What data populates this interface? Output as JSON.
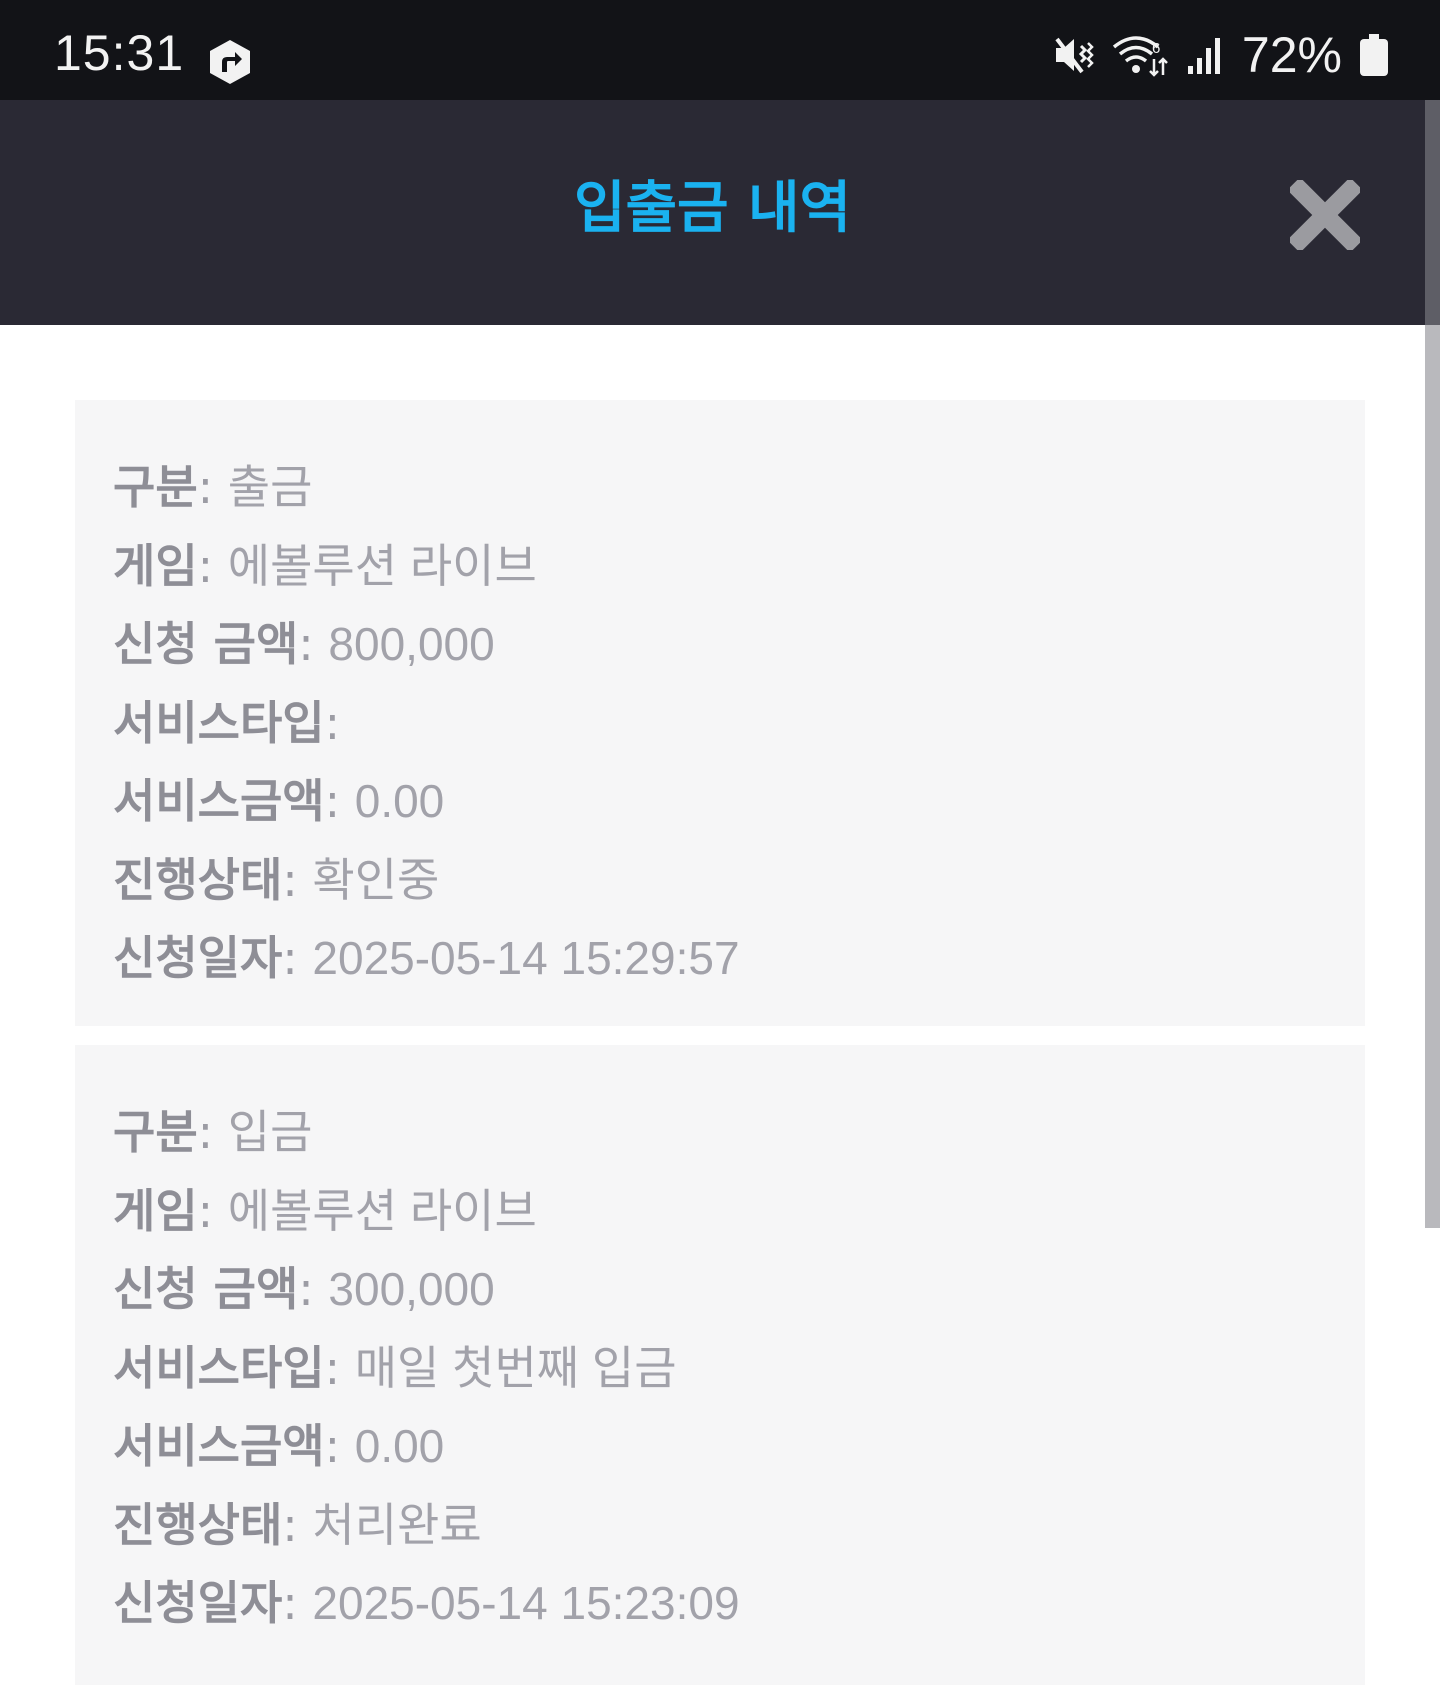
{
  "status_bar": {
    "time": "15:31",
    "battery": "72%"
  },
  "header": {
    "title": "입출금 내역"
  },
  "records": [
    {
      "category_label": "구분",
      "category": "출금",
      "game_label": "게임",
      "game": "에볼루션 라이브",
      "amount_label": "신청 금액",
      "amount": "800,000",
      "service_type_label": "서비스타입",
      "service_type": "",
      "service_amount_label": "서비스금액",
      "service_amount": "0.00",
      "status_label": "진행상태",
      "status": "확인중",
      "date_label": "신청일자",
      "date": "2025-05-14 15:29:57"
    },
    {
      "category_label": "구분",
      "category": "입금",
      "game_label": "게임",
      "game": "에볼루션 라이브",
      "amount_label": "신청 금액",
      "amount": "300,000",
      "service_type_label": "서비스타입",
      "service_type": "매일 첫번째 입금",
      "service_amount_label": "서비스금액",
      "service_amount": "0.00",
      "status_label": "진행상태",
      "status": "처리완료",
      "date_label": "신청일자",
      "date": "2025-05-14 15:23:09"
    }
  ],
  "icons": {
    "app": "share-arrow-icon",
    "mute": "vibrate-mute-icon",
    "wifi": "wifi-icon",
    "signal": "signal-icon",
    "battery": "battery-icon",
    "close": "close-icon"
  },
  "colors": {
    "title": "#1ab2f0",
    "header_bg": "#2a2934",
    "status_bg": "#121317",
    "card_bg": "#f6f6f7"
  }
}
